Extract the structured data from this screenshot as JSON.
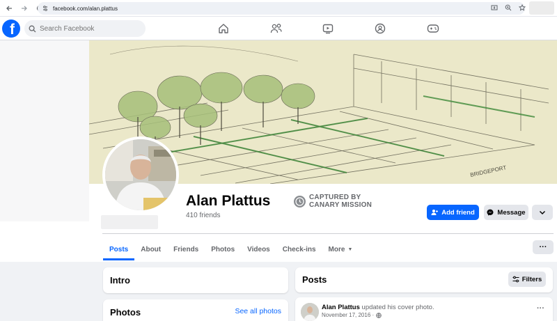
{
  "browser": {
    "url": "facebook.com/alan.plattus",
    "back_icon": "arrow-left-icon",
    "forward_icon": "arrow-right-icon",
    "reload_icon": "reload-icon"
  },
  "fb_nav": {
    "logo_letter": "f",
    "search_placeholder": "Search Facebook",
    "icons": [
      "home-icon",
      "friends-icon",
      "video-icon",
      "groups-icon",
      "gaming-icon"
    ]
  },
  "profile": {
    "name": "Alan Plattus",
    "friends": "410 friends",
    "badge_line1": "CAPTURED BY",
    "badge_line2": "CANARY MISSION"
  },
  "actions": {
    "add_friend": "Add friend",
    "message": "Message"
  },
  "tabs": [
    {
      "label": "Posts",
      "active": true
    },
    {
      "label": "About",
      "active": false
    },
    {
      "label": "Friends",
      "active": false
    },
    {
      "label": "Photos",
      "active": false
    },
    {
      "label": "Videos",
      "active": false
    },
    {
      "label": "Check-ins",
      "active": false
    },
    {
      "label": "More",
      "active": false
    }
  ],
  "intro": {
    "title": "Intro"
  },
  "photos": {
    "title": "Photos",
    "see_all": "See all photos"
  },
  "posts": {
    "title": "Posts",
    "filters": "Filters",
    "items": [
      {
        "author": "Alan Plattus",
        "action": " updated his cover photo.",
        "date": "November 17, 2016 ·"
      }
    ]
  },
  "colors": {
    "accent": "#0866ff",
    "background": "#f0f2f5",
    "secondary_button": "#e4e6eb"
  }
}
